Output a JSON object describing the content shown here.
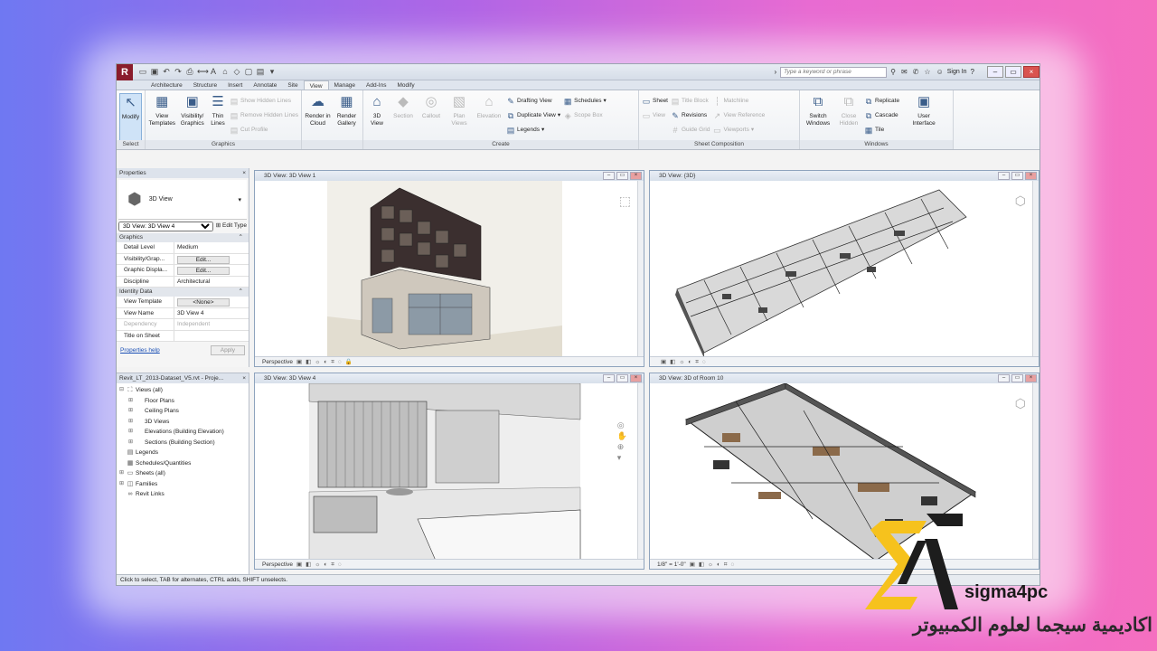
{
  "titlebar": {
    "search_placeholder": "Type a keyword or phrase",
    "sign_in": "Sign In"
  },
  "tabs": [
    "Architecture",
    "Structure",
    "Insert",
    "Annotate",
    "Site",
    "View",
    "Manage",
    "Add-Ins",
    "Modify"
  ],
  "active_tab": "View",
  "ribbon": {
    "select": {
      "modify": "Modify",
      "title": "Select"
    },
    "graphics": {
      "view_templates": "View Templates",
      "visibility_graphics": "Visibility/ Graphics",
      "thin_lines": "Thin Lines",
      "show_hidden_lines": "Show Hidden Lines",
      "remove_hidden_lines": "Remove Hidden Lines",
      "cut_profile": "Cut Profile",
      "title": "Graphics"
    },
    "render": {
      "render_cloud": "Render in Cloud",
      "render_gallery": "Render Gallery"
    },
    "create": {
      "three_d_view": "3D View",
      "section": "Section",
      "callout": "Callout",
      "plan_views": "Plan Views",
      "elevation": "Elevation",
      "drafting_view": "Drafting View",
      "duplicate_view": "Duplicate View",
      "legends": "Legends",
      "schedules": "Schedules",
      "scope_box": "Scope Box",
      "title": "Create"
    },
    "sheet_composition": {
      "sheet": "Sheet",
      "view": "View",
      "title_block": "Title Block",
      "revisions": "Revisions",
      "guide_grid": "Guide Grid",
      "matchline": "Matchline",
      "view_reference": "View Reference",
      "viewports": "Viewports",
      "title": "Sheet Composition"
    },
    "windows": {
      "switch_windows": "Switch Windows",
      "close_hidden": "Close Hidden",
      "replicate": "Replicate",
      "cascade": "Cascade",
      "tile": "Tile",
      "user_interface": "User Interface",
      "title": "Windows"
    }
  },
  "properties": {
    "header": "Properties",
    "type_name": "3D View",
    "instance": "3D View: 3D View 4",
    "edit_type": "Edit Type",
    "groups": [
      {
        "name": "Graphics",
        "rows": [
          {
            "key": "Detail Level",
            "value": "Medium"
          },
          {
            "key": "Visibility/Grap...",
            "value": "Edit...",
            "button": true
          },
          {
            "key": "Graphic Displa...",
            "value": "Edit...",
            "button": true
          },
          {
            "key": "Discipline",
            "value": "Architectural"
          }
        ]
      },
      {
        "name": "Identity Data",
        "rows": [
          {
            "key": "View Template",
            "value": "<None>",
            "button": true
          },
          {
            "key": "View Name",
            "value": "3D View 4"
          },
          {
            "key": "Dependency",
            "value": "Independent",
            "disabled": true
          },
          {
            "key": "Title on Sheet",
            "value": ""
          }
        ]
      }
    ],
    "help_link": "Properties help",
    "apply": "Apply"
  },
  "browser": {
    "header": "Revit_LT_2013-Dataset_V5.rvt - Proje...",
    "nodes": [
      {
        "label": "Views (all)",
        "level": 0,
        "toggle": "-",
        "icon": "⛶"
      },
      {
        "label": "Floor Plans",
        "level": 1,
        "toggle": "+",
        "icon": ""
      },
      {
        "label": "Ceiling Plans",
        "level": 1,
        "toggle": "+",
        "icon": ""
      },
      {
        "label": "3D Views",
        "level": 1,
        "toggle": "+",
        "icon": ""
      },
      {
        "label": "Elevations (Building Elevation)",
        "level": 1,
        "toggle": "+",
        "icon": ""
      },
      {
        "label": "Sections (Building Section)",
        "level": 1,
        "toggle": "+",
        "icon": ""
      },
      {
        "label": "Legends",
        "level": 0,
        "toggle": "",
        "icon": "▤"
      },
      {
        "label": "Schedules/Quantities",
        "level": 0,
        "toggle": "",
        "icon": "▦"
      },
      {
        "label": "Sheets (all)",
        "level": 0,
        "toggle": "+",
        "icon": "▭"
      },
      {
        "label": "Families",
        "level": 0,
        "toggle": "+",
        "icon": "◫"
      },
      {
        "label": "Revit Links",
        "level": 0,
        "toggle": "",
        "icon": "∞"
      }
    ]
  },
  "viewports": [
    {
      "title": "3D View: 3D View 1",
      "footer": "Perspective"
    },
    {
      "title": "3D View: {3D}",
      "footer": ""
    },
    {
      "title": "3D View: 3D View 4",
      "footer": "Perspective"
    },
    {
      "title": "3D View: 3D of Room 10",
      "footer": "1/8\" = 1'-0\""
    }
  ],
  "status_bar": "Click to select, TAB for alternates, CTRL adds, SHIFT unselects.",
  "watermark": {
    "brand": "sigma4pc",
    "arabic": "اكاديمية سيجما لعلوم الكمبيوتر"
  },
  "colors": {
    "logo_yellow": "#f6c21d",
    "logo_dark": "#1d1d1d",
    "revit_red": "#8a1c2c"
  }
}
